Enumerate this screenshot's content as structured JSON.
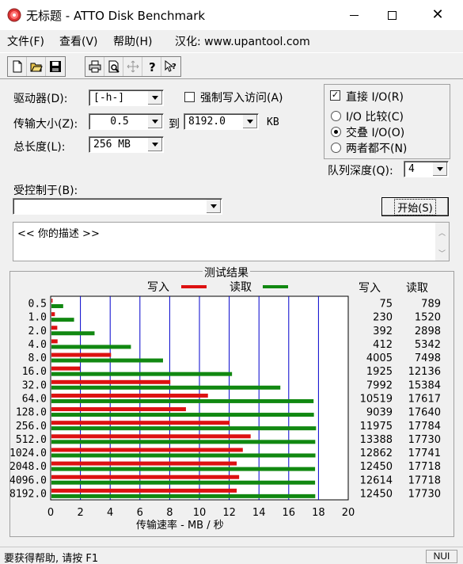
{
  "window": {
    "title": "无标题 - ATTO Disk Benchmark",
    "icon": "disk-benchmark-app-icon"
  },
  "menu": {
    "file": "文件(F)",
    "view": "查看(V)",
    "help": "帮助(H)",
    "localization": "汉化: www.upantool.com"
  },
  "toolbar": {
    "icons": [
      "new-file-icon",
      "open-folder-icon",
      "save-icon",
      "print-icon",
      "print-preview-icon",
      "move-icon",
      "help-icon",
      "context-help-icon"
    ]
  },
  "settings": {
    "drive_label": "驱动器(D):",
    "drive_value": "[-h-]",
    "force_write_label": "强制写入访问(A)",
    "force_write_checked": false,
    "transfer_size_label": "传输大小(Z):",
    "transfer_from": "0.5",
    "to_label": "到",
    "transfer_to": "8192.0",
    "unit": "KB",
    "total_length_label": "总长度(L):",
    "total_length_value": "256 MB",
    "controlled_by_label": "受控制于(B):",
    "controlled_by_value": ""
  },
  "io": {
    "direct_label": "直接 I/O(R)",
    "direct_checked": true,
    "options": [
      {
        "label": "I/O 比较(C)",
        "selected": false
      },
      {
        "label": "交叠 I/O(O)",
        "selected": true
      },
      {
        "label": "两者都不(N)",
        "selected": false
      }
    ],
    "queue_depth_label": "队列深度(Q):",
    "queue_depth_value": "4"
  },
  "start_button": "开始(S)",
  "description": "<<   你的描述   >>",
  "results": {
    "title": "测试结果",
    "write_legend": "写入",
    "read_legend": "读取",
    "write_col": "写入",
    "read_col": "读取",
    "xlabel": "传输速率 - MB / 秒",
    "write_color": "#dd1111",
    "read_color": "#118811"
  },
  "chart_data": {
    "type": "bar",
    "orientation": "horizontal",
    "categories": [
      "0.5",
      "1.0",
      "2.0",
      "4.0",
      "8.0",
      "16.0",
      "32.0",
      "64.0",
      "128.0",
      "256.0",
      "512.0",
      "1024.0",
      "2048.0",
      "4096.0",
      "8192.0"
    ],
    "series": [
      {
        "name": "写入",
        "values": [
          75,
          230,
          392,
          412,
          4005,
          1925,
          7992,
          10519,
          9039,
          11975,
          13388,
          12862,
          12450,
          12614,
          12450
        ]
      },
      {
        "name": "读取",
        "values": [
          789,
          1520,
          2898,
          5342,
          7498,
          12136,
          15384,
          17617,
          17640,
          17784,
          17730,
          17741,
          17718,
          17718,
          17730
        ]
      }
    ],
    "x_ticks": [
      "0",
      "2",
      "4",
      "6",
      "8",
      "10",
      "12",
      "14",
      "16",
      "18",
      "20"
    ],
    "xlim": [
      0,
      20000
    ],
    "grid": true,
    "xlabel": "传输速率 - MB / 秒"
  },
  "status": {
    "text": "要获得帮助, 请按 F1",
    "indicator": "NUI"
  }
}
